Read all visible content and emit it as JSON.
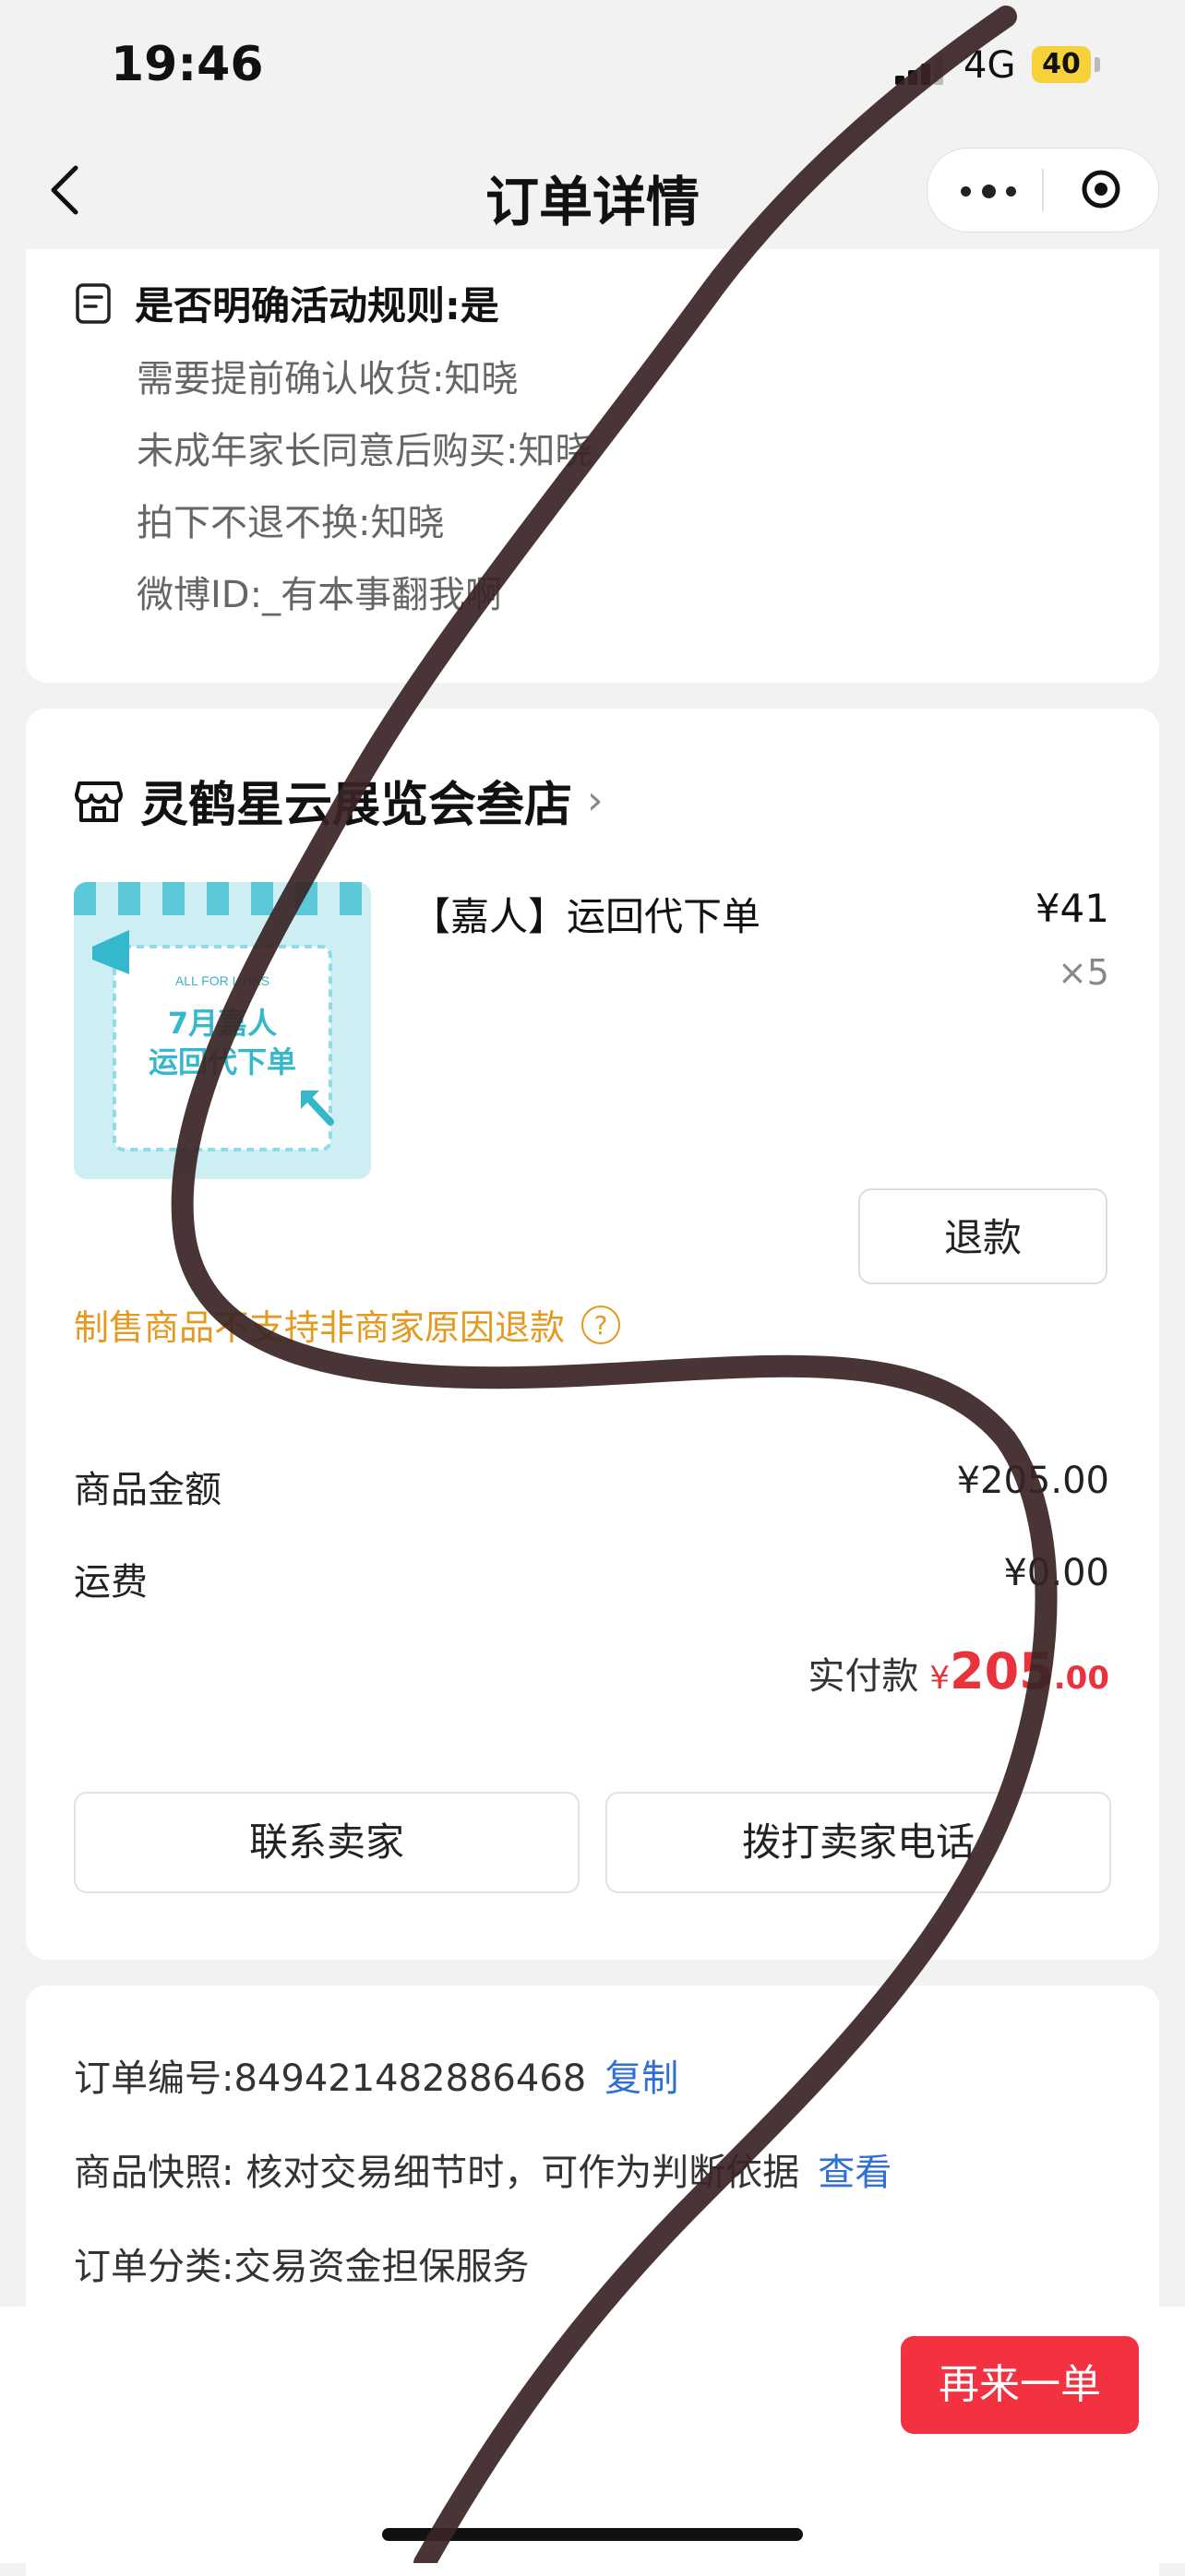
{
  "status_bar": {
    "time": "19:46",
    "network": "4G",
    "battery": "40"
  },
  "nav": {
    "title": "订单详情"
  },
  "rules": {
    "heading": "是否明确活动规则:是",
    "lines": [
      "需要提前确认收货:知晓",
      "未成年家长同意后购买:知晓",
      "拍下不退不换:知晓",
      "微博ID:_有本事翻我啊"
    ]
  },
  "shop": {
    "name": "灵鹤星云展览会叁店",
    "product": {
      "title": "【嘉人】运回代下单",
      "price": "¥41",
      "qty": "×5",
      "image_text": {
        "top": "ALL FOR LINKS",
        "main1": "7月嘉人",
        "main2": "运回代下单"
      }
    },
    "refund_label": "退款",
    "notice": "制售商品不支持非商家原因退款",
    "notice_help": "?",
    "goods_amount_label": "商品金额",
    "goods_amount_value": "¥205.00",
    "shipping_label": "运费",
    "shipping_value": "¥0.00",
    "paid_label": "实付款",
    "paid_currency": "¥",
    "paid_integer": "205",
    "paid_decimal": ".00",
    "contact_seller": "联系卖家",
    "call_seller": "拨打卖家电话"
  },
  "order_info": {
    "order_no_label": "订单编号:849421482886468",
    "copy_label": "复制",
    "snapshot_label": "商品快照: 核对交易细节时，可作为判断依据",
    "snapshot_link": "查看",
    "category_label": "订单分类:交易资金担保服务"
  },
  "bottom": {
    "reorder_label": "再来一单"
  },
  "colors": {
    "accent_red": "#f23240",
    "notice_orange": "#e49a20",
    "link_blue": "#2f6fd6",
    "scribble": "#3a2424"
  }
}
